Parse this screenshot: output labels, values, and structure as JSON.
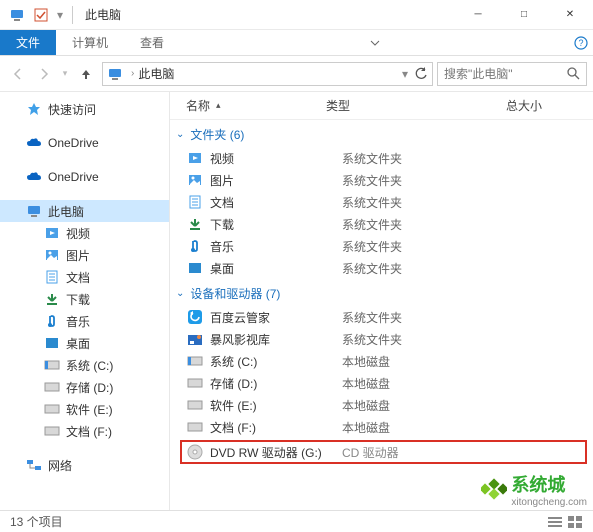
{
  "window": {
    "title": "此电脑",
    "min": "─",
    "max": "□",
    "close": "✕"
  },
  "ribbon": {
    "file": "文件",
    "computer": "计算机",
    "view": "查看"
  },
  "address": {
    "root": "此电脑"
  },
  "search": {
    "placeholder": "搜索\"此电脑\""
  },
  "columns": {
    "name": "名称",
    "type": "类型",
    "size": "总大小"
  },
  "sidebar": {
    "quick": "快速访问",
    "onedrive1": "OneDrive",
    "onedrive2": "OneDrive",
    "thispc": "此电脑",
    "items": [
      {
        "label": "视频"
      },
      {
        "label": "图片"
      },
      {
        "label": "文档"
      },
      {
        "label": "下载"
      },
      {
        "label": "音乐"
      },
      {
        "label": "桌面"
      },
      {
        "label": "系统 (C:)"
      },
      {
        "label": "存储 (D:)"
      },
      {
        "label": "软件 (E:)"
      },
      {
        "label": "文档 (F:)"
      }
    ],
    "network": "网络"
  },
  "groups": {
    "folders": {
      "label": "文件夹 (6)",
      "items": [
        {
          "name": "视频",
          "type": "系统文件夹"
        },
        {
          "name": "图片",
          "type": "系统文件夹"
        },
        {
          "name": "文档",
          "type": "系统文件夹"
        },
        {
          "name": "下载",
          "type": "系统文件夹"
        },
        {
          "name": "音乐",
          "type": "系统文件夹"
        },
        {
          "name": "桌面",
          "type": "系统文件夹"
        }
      ]
    },
    "drives": {
      "label": "设备和驱动器 (7)",
      "items": [
        {
          "name": "百度云管家",
          "type": "系统文件夹"
        },
        {
          "name": "暴风影视库",
          "type": "系统文件夹"
        },
        {
          "name": "系统 (C:)",
          "type": "本地磁盘"
        },
        {
          "name": "存储 (D:)",
          "type": "本地磁盘"
        },
        {
          "name": "软件 (E:)",
          "type": "本地磁盘"
        },
        {
          "name": "文档 (F:)",
          "type": "本地磁盘"
        }
      ],
      "highlight": {
        "name": "DVD RW 驱动器 (G:)",
        "type": "CD 驱动器"
      }
    }
  },
  "status": {
    "count": "13 个项目"
  },
  "watermark": {
    "brand": "系统城",
    "url": "xitongcheng.com"
  }
}
